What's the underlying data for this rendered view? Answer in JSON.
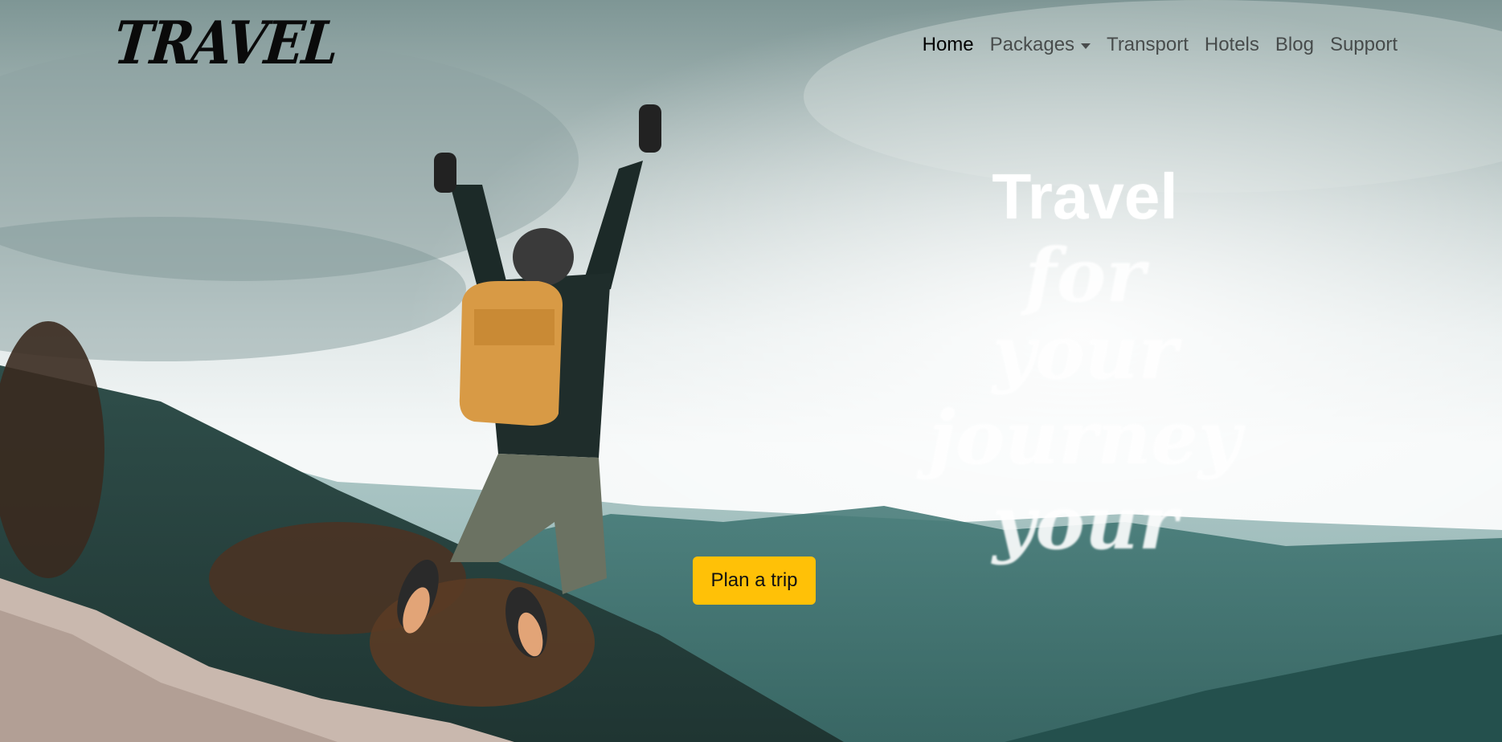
{
  "brand": {
    "logo_text": "TRAVEL"
  },
  "nav": {
    "items": [
      {
        "label": "Home",
        "active": true
      },
      {
        "label": "Packages",
        "has_dropdown": true
      },
      {
        "label": "Transport"
      },
      {
        "label": "Hotels"
      },
      {
        "label": "Blog"
      },
      {
        "label": "Support"
      }
    ],
    "dropdown_icon": "caret-down-icon"
  },
  "hero": {
    "title": "Travel",
    "subtitle_lines": [
      "for your",
      "journey",
      "your"
    ],
    "cta_label": "Plan a trip"
  },
  "colors": {
    "cta_background": "#ffc107",
    "nav_active": "#000000",
    "nav_inactive": "#4a4a4a",
    "hero_text": "#ffffff"
  }
}
